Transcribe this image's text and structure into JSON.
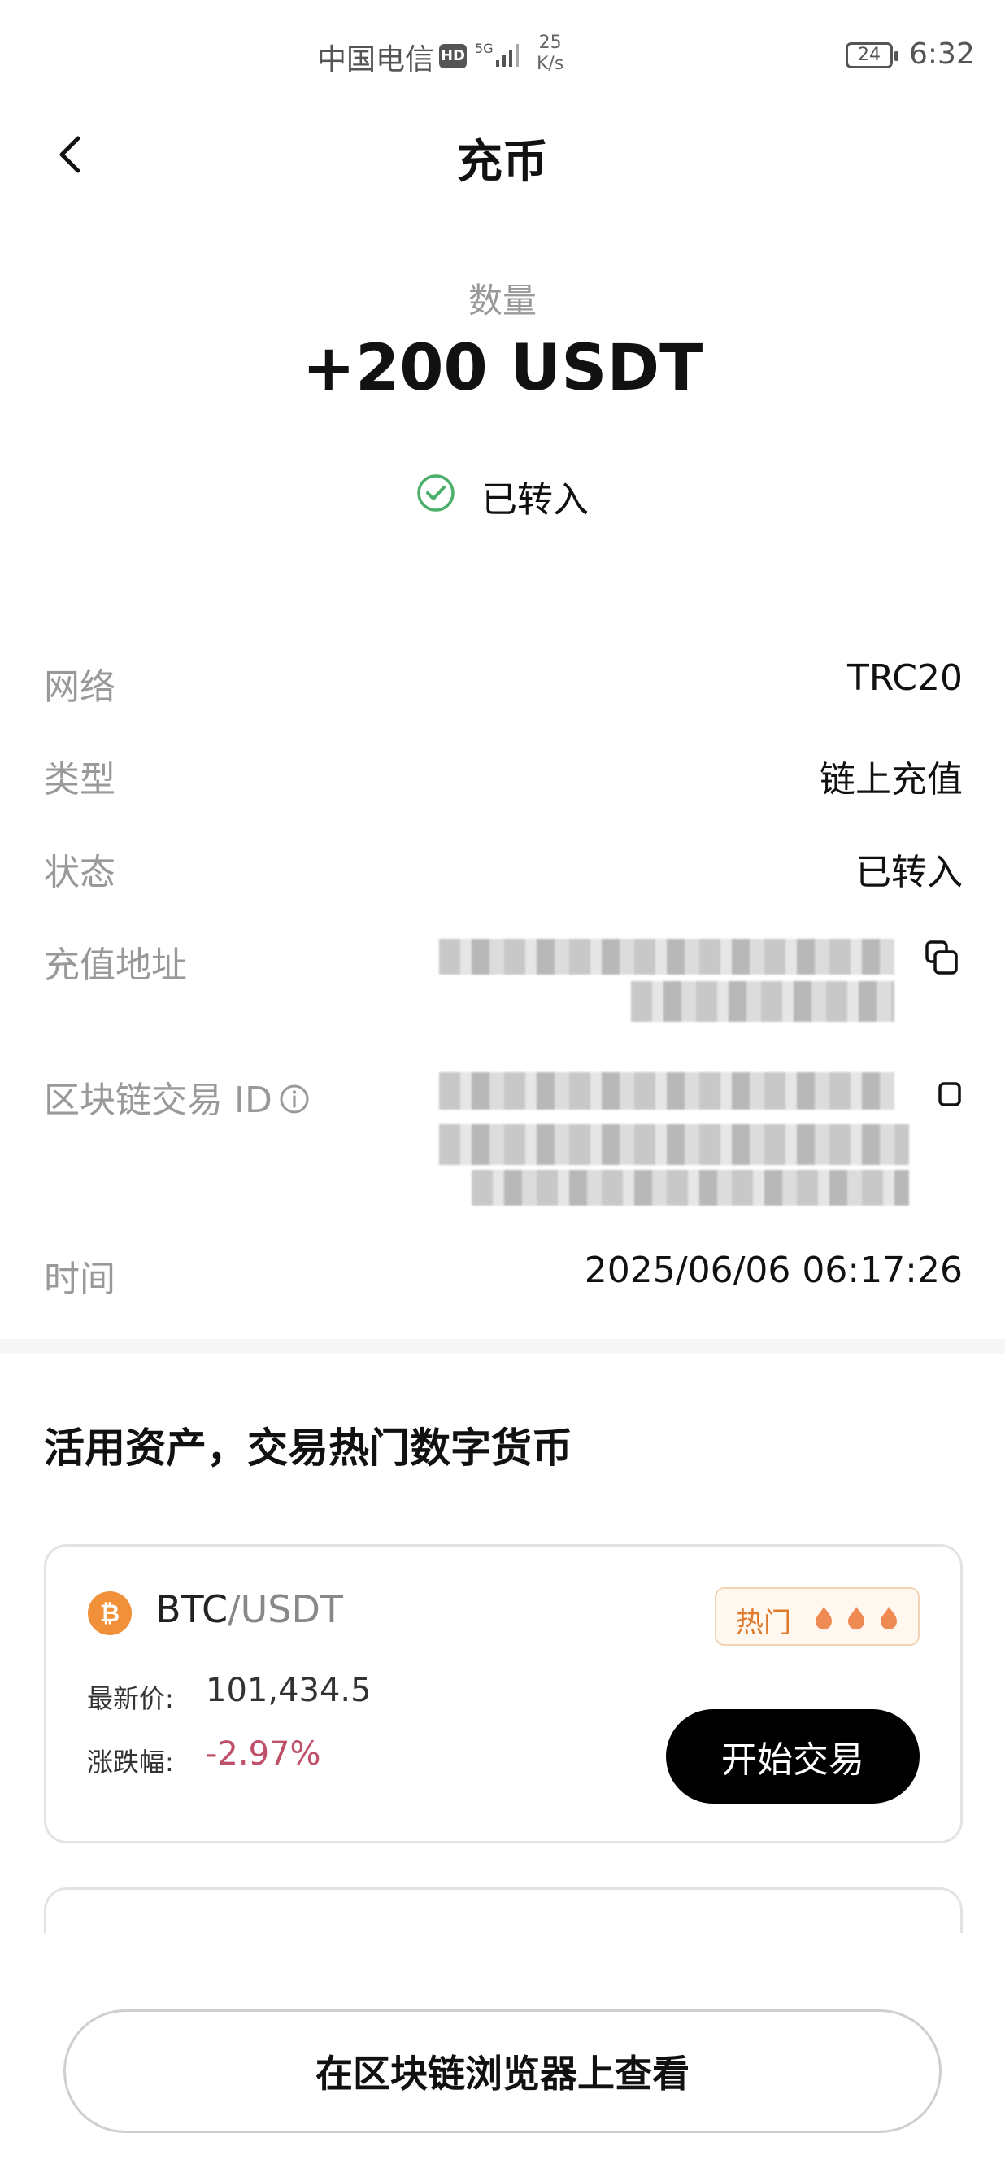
{
  "status_bar": {
    "carrier": "中国电信",
    "hd": "HD",
    "network": "5G",
    "speed_value": "25",
    "speed_unit": "K/s",
    "battery": "24",
    "time": "6:32"
  },
  "header": {
    "title": "充币"
  },
  "amount": {
    "label": "数量",
    "value": "+200 USDT"
  },
  "status": {
    "text": "已转入",
    "color": "#4caf6a"
  },
  "details": {
    "network_label": "网络",
    "network_value": "TRC20",
    "type_label": "类型",
    "type_value": "链上充值",
    "state_label": "状态",
    "state_value": "已转入",
    "address_label": "充值地址",
    "txid_label": "区块链交易 ID",
    "time_label": "时间",
    "time_value": "2025/06/06 06:17:26"
  },
  "section": {
    "title": "活用资产，交易热门数字货币"
  },
  "card": {
    "base": "BTC",
    "quote": "/USDT",
    "hot_label": "热门",
    "price_label": "最新价:",
    "price_value": "101,434.5",
    "change_label": "涨跌幅:",
    "change_value": "-2.97%",
    "change_color": "#c0506a",
    "trade_button": "开始交易",
    "coin_icon": "bitcoin-icon",
    "coin_color": "#f0913a"
  },
  "footer": {
    "explorer_button": "在区块链浏览器上查看"
  }
}
